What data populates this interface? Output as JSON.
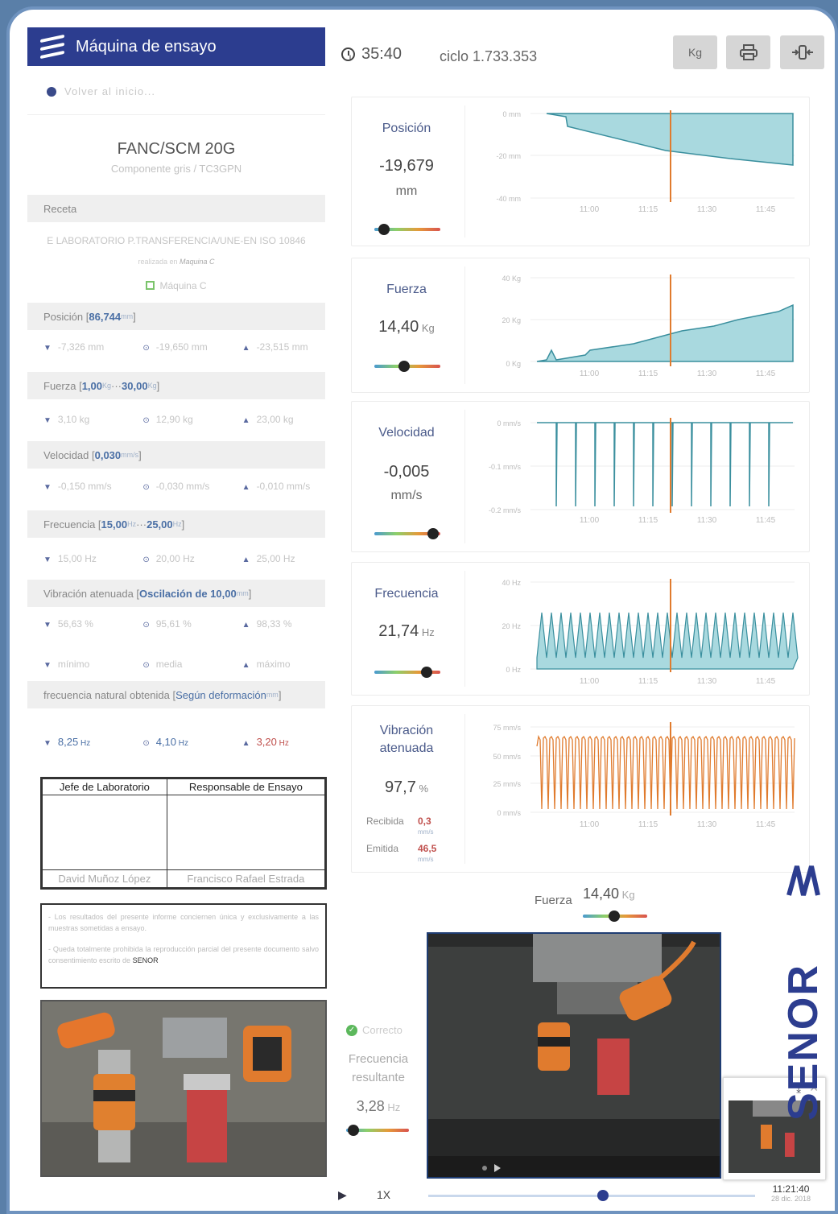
{
  "app": {
    "title": "Máquina de ensayo",
    "back": "Volver al inicio..."
  },
  "toolbar": {
    "timer": "35:40",
    "cycle": "ciclo 1.733.353",
    "unit_btn": "Kg"
  },
  "component": {
    "name": "FANC/SCM 20G",
    "desc": "Componente gris / TC3GPN"
  },
  "recipe": {
    "label": "Receta",
    "standard": "E LABORATORIO P.TRANSFERENCIA/UNE-EN ISO 10846",
    "made_prefix": "realizada en ",
    "made_machine": "Maquina C",
    "machine": "Máquina C"
  },
  "params": {
    "position": {
      "name": "Posición [",
      "val": "86,744",
      "unit": " mm",
      "close": "]",
      "min": "-7,326 mm",
      "avg": "-19,650 mm",
      "max": "-23,515 mm"
    },
    "force": {
      "name": "Fuerza [",
      "v1": "1,00",
      "u1": " Kg",
      "sep": " ··· ",
      "v2": "30,00",
      "u2": " Kg",
      "close": "]",
      "min": "3,10 kg",
      "avg": "12,90 kg",
      "max": "23,00 kg"
    },
    "speed": {
      "name": "Velocidad [",
      "val": "0,030",
      "unit": " mm/s",
      "close": "]",
      "min": "-0,150 mm/s",
      "avg": "-0,030 mm/s",
      "max": "-0,010 mm/s"
    },
    "freq": {
      "name": "Frecuencia [",
      "v1": "15,00",
      "u1": " Hz",
      "sep": " ··· ",
      "v2": "25,00",
      "u2": " Hz",
      "close": "]",
      "min": "15,00 Hz",
      "avg": "20,00 Hz",
      "max": "25,00 Hz"
    },
    "vib": {
      "name": "Vibración atenuada [",
      "val": "Oscilación de 10,00",
      "unit": " mm",
      "close": "]",
      "min": "56,63 %",
      "avg": "95,61 %",
      "max": "98,33 %"
    },
    "legend": {
      "min": "mínimo",
      "avg": "media",
      "max": "máximo"
    },
    "natural": {
      "name": "frecuencia natural obtenida [",
      "val": "Según deformación",
      "unit": " mm",
      "close": " ]",
      "min": "8,25",
      "avg": "4,10",
      "max": "3,20",
      "u": " Hz"
    }
  },
  "signatures": {
    "h1": "Jefe de Laboratorio",
    "h2": "Responsable de Ensayo",
    "n1": "David Muñoz López",
    "n2": "Francisco Rafael Estrada"
  },
  "notes": {
    "n1": "- Los resultados del presente informe conciernen única y exclusivamente a las muestras sometidas a ensayo.",
    "n2": "- Queda totalmente prohibida la reproducción parcial del presente documento salvo consentimiento escrito de ",
    "brand": "SENOR"
  },
  "panels": {
    "position": {
      "label": "Posición",
      "value": "-19,679",
      "unit": "mm",
      "ticks": [
        "0 mm",
        "-20 mm",
        "-40 mm"
      ]
    },
    "force": {
      "label": "Fuerza",
      "value": "14,40",
      "unit": " Kg",
      "ticks": [
        "40 Kg",
        "20 Kg",
        "0 Kg"
      ]
    },
    "speed": {
      "label": "Velocidad",
      "value": "-0,005",
      "unit": "mm/s",
      "ticks": [
        "0 mm/s",
        "-0.1 mm/s",
        "-0.2 mm/s"
      ]
    },
    "freq": {
      "label": "Frecuencia",
      "value": "21,74",
      "unit": " Hz",
      "ticks": [
        "40 Hz",
        "20 Hz",
        "0 Hz"
      ]
    },
    "vib": {
      "label1": "Vibración",
      "label2": "atenuada",
      "value": "97,7",
      "unit": " %",
      "ticks": [
        "75 mm/s",
        "50 mm/s",
        "25 mm/s",
        "0 mm/s"
      ],
      "rx_label": "Recibida",
      "rx_val": "0,3",
      "rx_unit": "mm/s",
      "tx_label": "Emitida",
      "tx_val": "46,5",
      "tx_unit": "mm/s"
    },
    "times": [
      "11:00",
      "11:15",
      "11:30",
      "11:45"
    ]
  },
  "bottom": {
    "force_label": "Fuerza",
    "force_val": "14,40",
    "force_unit": " Kg",
    "status": "Correcto",
    "res_l1": "Frecuencia",
    "res_l2": "resultante",
    "res_val": "3,28",
    "res_unit": " Hz",
    "speed": "1X",
    "time": "11:21:40",
    "date": "28 dic. 2018",
    "brand": "SENOR"
  },
  "colors": {
    "header": "#2c3d8f",
    "fill": "#a9d9df",
    "line": "#3a8f9e",
    "marker": "#e07b2e",
    "vib": "#e07b2e"
  },
  "chart_data": [
    {
      "type": "area",
      "title": "Posición",
      "x": [
        "11:00",
        "11:15",
        "11:30",
        "11:45"
      ],
      "ylim": [
        -40,
        0
      ],
      "values": [
        -5,
        -13,
        -18,
        -23
      ]
    },
    {
      "type": "area",
      "title": "Fuerza",
      "x": [
        "11:00",
        "11:15",
        "11:30",
        "11:45"
      ],
      "ylim": [
        0,
        40
      ],
      "values": [
        2,
        10,
        18,
        27
      ]
    },
    {
      "type": "line",
      "title": "Velocidad",
      "x": [
        "11:00",
        "11:15",
        "11:30",
        "11:45"
      ],
      "ylim": [
        -0.2,
        0
      ],
      "values": [
        0,
        -0.2,
        0,
        -0.2
      ]
    },
    {
      "type": "area",
      "title": "Frecuencia",
      "x": [
        "11:00",
        "11:15",
        "11:30",
        "11:45"
      ],
      "ylim": [
        0,
        40
      ],
      "values": [
        14,
        25,
        14,
        25
      ]
    },
    {
      "type": "line",
      "title": "Vibración atenuada",
      "x": [
        "11:00",
        "11:15",
        "11:30",
        "11:45"
      ],
      "ylim": [
        0,
        75
      ],
      "values": [
        50,
        70,
        50,
        70
      ]
    }
  ]
}
